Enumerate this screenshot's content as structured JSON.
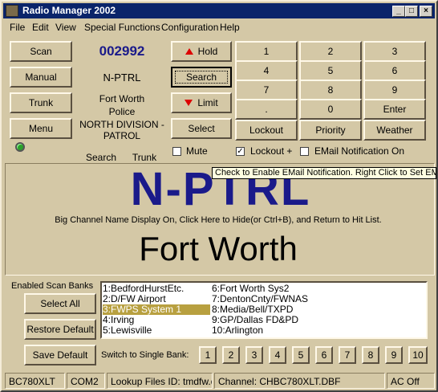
{
  "window": {
    "title": "Radio Manager 2002"
  },
  "menu": [
    "File",
    "Edit",
    "View",
    "Special Functions",
    "Configuration",
    "Help"
  ],
  "left_buttons": {
    "scan": "Scan",
    "manual": "Manual",
    "trunk": "Trunk",
    "menu": "Menu"
  },
  "channel_info": {
    "number": "002992",
    "name": "N-PTRL",
    "city": "Fort Worth",
    "service": "Police",
    "division": "NORTH DIVISION - PATROL",
    "mode_search": "Search",
    "mode_trunk": "Trunk"
  },
  "mid_buttons": {
    "hold": "Hold",
    "search": "Search",
    "limit": "Limit",
    "select": "Select"
  },
  "keypad": [
    "1",
    "2",
    "3",
    "4",
    "5",
    "6",
    "7",
    "8",
    "9",
    ".",
    "0",
    "Enter"
  ],
  "function_buttons": {
    "lockout": "Lockout",
    "priority": "Priority",
    "weather": "Weather"
  },
  "checks": {
    "mute": {
      "label": "Mute",
      "checked": false
    },
    "lockout_plus": {
      "label": "Lockout +",
      "checked": true
    },
    "email": {
      "label": "EMail Notification On",
      "checked": false
    }
  },
  "tooltip": "Check to Enable EMail Notification. Right Click to Set EMail",
  "big_display": {
    "name": "N-PTRL",
    "hint": "Big Channel Name Display On, Click Here to Hide(or Ctrl+B), and Return to Hit List.",
    "city": "Fort Worth"
  },
  "scan_banks": {
    "heading": "Enabled Scan Banks",
    "select_all": "Select All",
    "restore_default": "Restore Default",
    "save_default": "Save Default",
    "switch_label": "Switch to Single Bank:",
    "banks_left": [
      "1:BedfordHurstEtc.",
      "2:D/FW Airport",
      "3:FWPS System 1",
      "4:Irving",
      "5:Lewisville"
    ],
    "banks_right": [
      "6:Fort Worth Sys2",
      "7:DentonCnty/FWNAS",
      "8:Media/Bell/TXPD",
      "9:GP/Dallas FD&PD",
      "10:Arlington"
    ],
    "selected_index": 2,
    "single_banks": [
      "1",
      "2",
      "3",
      "4",
      "5",
      "6",
      "7",
      "8",
      "9",
      "10"
    ]
  },
  "statusbar": {
    "model": "BC780XLT",
    "port": "COM2",
    "lookup": "Lookup Files ID: tmdfw.dbf",
    "channel": "Channel: CHBC780XLT.DBF",
    "ac": "AC Off"
  },
  "colors": {
    "title_bg": "#0a246a",
    "channel_blue": "#1a1a8a",
    "selected_bank": "#b8a040",
    "face": "#d4c8a6"
  }
}
